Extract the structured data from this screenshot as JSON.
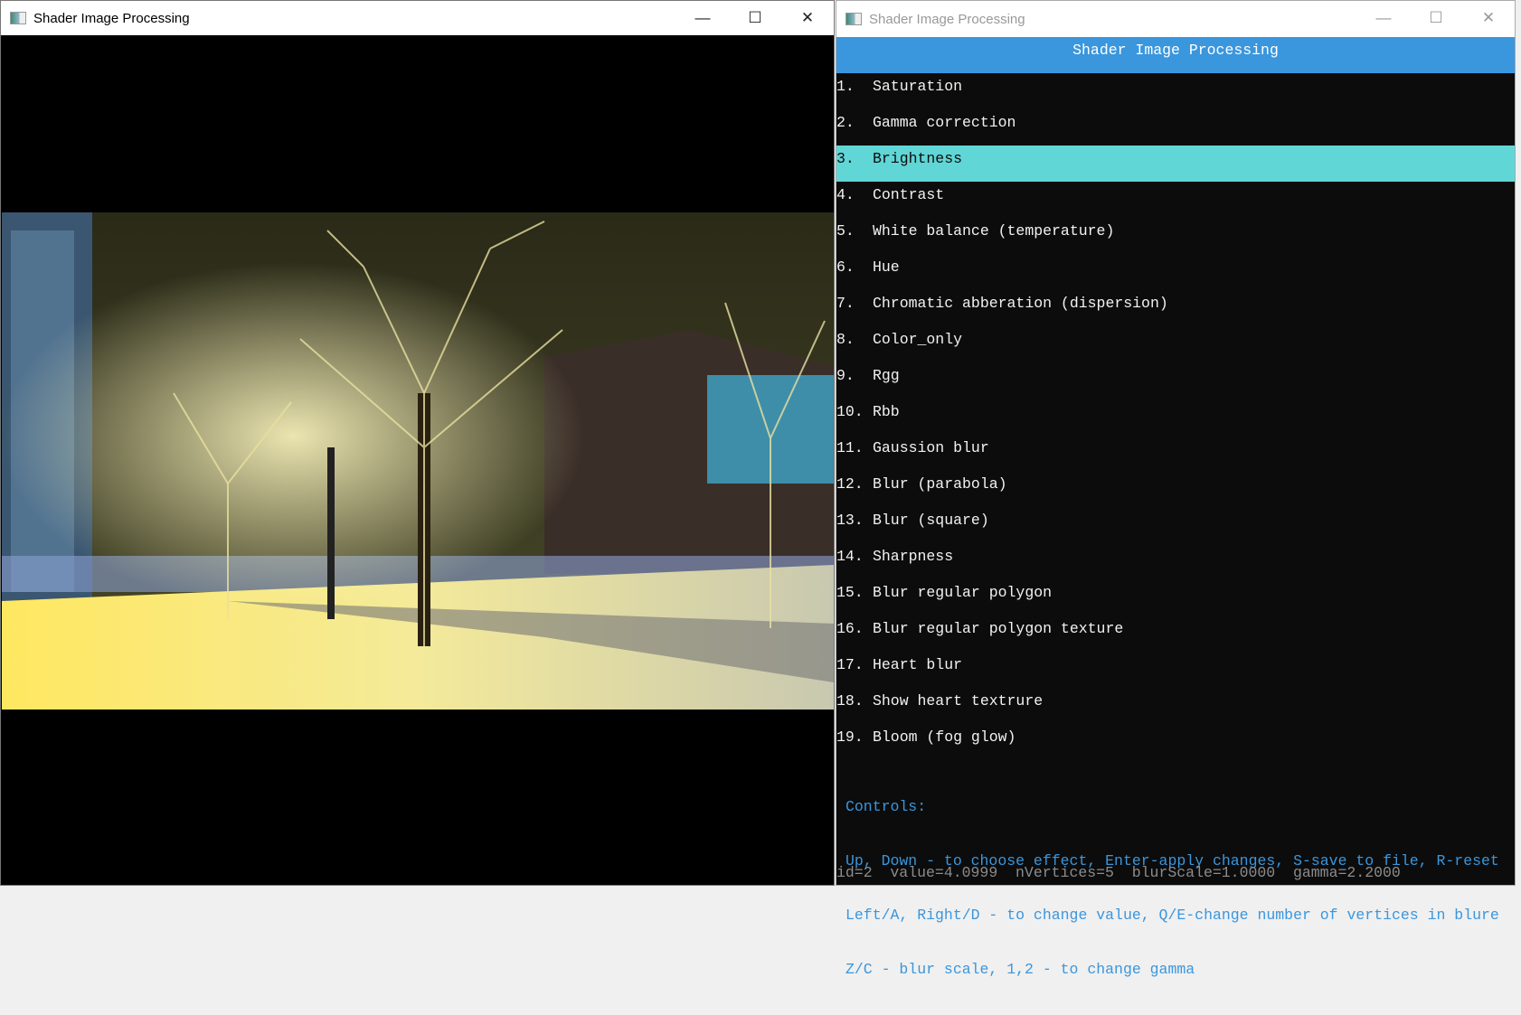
{
  "left_window": {
    "title": "Shader Image Processing",
    "minimize": "—",
    "maximize": "☐",
    "close": "✕"
  },
  "right_window": {
    "title": "Shader Image Processing",
    "minimize": "—",
    "maximize": "☐",
    "close": "✕",
    "header": "Shader Image Processing",
    "selected_index": 3,
    "items": [
      {
        "num": "1.",
        "label": "Saturation"
      },
      {
        "num": "2.",
        "label": "Gamma correction"
      },
      {
        "num": "3.",
        "label": "Brightness"
      },
      {
        "num": "4.",
        "label": "Contrast"
      },
      {
        "num": "5.",
        "label": "White balance (temperature)"
      },
      {
        "num": "6.",
        "label": "Hue"
      },
      {
        "num": "7.",
        "label": "Chromatic abberation (dispersion)"
      },
      {
        "num": "8.",
        "label": "Color_only"
      },
      {
        "num": "9.",
        "label": "Rgg"
      },
      {
        "num": "10.",
        "label": "Rbb"
      },
      {
        "num": "11.",
        "label": "Gaussion blur"
      },
      {
        "num": "12.",
        "label": "Blur (parabola)"
      },
      {
        "num": "13.",
        "label": "Blur (square)"
      },
      {
        "num": "14.",
        "label": "Sharpness"
      },
      {
        "num": "15.",
        "label": "Blur regular polygon"
      },
      {
        "num": "16.",
        "label": "Blur regular polygon texture"
      },
      {
        "num": "17.",
        "label": "Heart blur"
      },
      {
        "num": "18.",
        "label": "Show heart textrure"
      },
      {
        "num": "19.",
        "label": "Bloom (fog glow)"
      }
    ],
    "controls": {
      "title": "Controls:",
      "lines": [
        "Up, Down - to choose effect, Enter-apply changes, S-save to file, R-reset",
        "Left/A, Right/D - to change value, Q/E-change number of vertices in blure",
        "Z/C - blur scale, 1,2 - to change gamma"
      ]
    },
    "status": "id=2  value=4.0999  nVertices=5  blurScale=1.0000  gamma=2.2000"
  },
  "colors": {
    "header": "#3a96dd",
    "selected": "#61d6d6",
    "controls": "#3a96dd",
    "console_bg": "#0c0c0c"
  }
}
